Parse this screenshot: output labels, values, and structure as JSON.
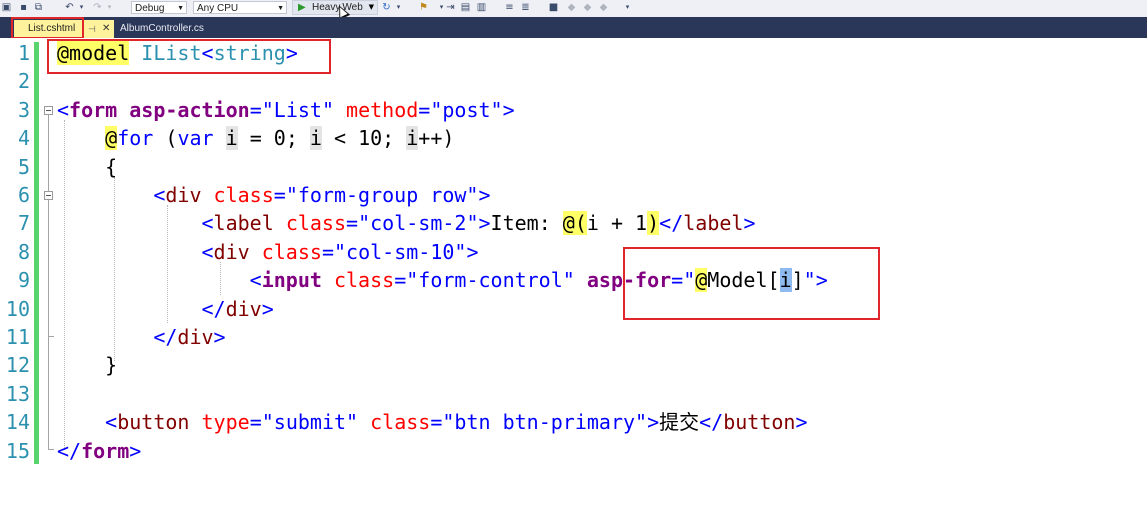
{
  "toolbar": {
    "config": "Debug",
    "platform": "Any CPU",
    "run_target": "Heavy.Web"
  },
  "tabs": [
    {
      "label": "List.cshtml",
      "active": true
    },
    {
      "label": "AlbumController.cs",
      "active": false
    }
  ],
  "editor": {
    "line_numbers": [
      "1",
      "2",
      "3",
      "4",
      "5",
      "6",
      "7",
      "8",
      "9",
      "10",
      "11",
      "12",
      "13",
      "14",
      "15"
    ],
    "lines": [
      {
        "num": "1",
        "tokens": [
          [
            "raz",
            "@model"
          ],
          [
            "txt",
            " "
          ],
          [
            "type",
            "IList"
          ],
          [
            "punc",
            "<"
          ],
          [
            "type",
            "string"
          ],
          [
            "punc",
            ">"
          ]
        ]
      },
      {
        "num": "2",
        "tokens": []
      },
      {
        "num": "3",
        "tokens": [
          [
            "punc",
            "<"
          ],
          [
            "tagb",
            "form"
          ],
          [
            "txt",
            " "
          ],
          [
            "helper",
            "asp-action"
          ],
          [
            "punc",
            "="
          ],
          [
            "str",
            "\"List\""
          ],
          [
            "txt",
            " "
          ],
          [
            "attr",
            "method"
          ],
          [
            "punc",
            "="
          ],
          [
            "str",
            "\"post\""
          ],
          [
            "punc",
            ">"
          ]
        ]
      },
      {
        "num": "4",
        "tokens": [
          [
            "txt",
            "    "
          ],
          [
            "raz",
            "@"
          ],
          [
            "kw",
            "for"
          ],
          [
            "txt",
            " ("
          ],
          [
            "kw",
            "var"
          ],
          [
            "txt",
            " "
          ],
          [
            "var",
            "i"
          ],
          [
            "txt",
            " = 0; "
          ],
          [
            "var",
            "i"
          ],
          [
            "txt",
            " < 10; "
          ],
          [
            "var",
            "i"
          ],
          [
            "txt",
            "++)"
          ]
        ]
      },
      {
        "num": "5",
        "tokens": [
          [
            "txt",
            "    {"
          ]
        ]
      },
      {
        "num": "6",
        "tokens": [
          [
            "txt",
            "        "
          ],
          [
            "punc",
            "<"
          ],
          [
            "tag",
            "div"
          ],
          [
            "txt",
            " "
          ],
          [
            "attr",
            "class"
          ],
          [
            "punc",
            "="
          ],
          [
            "str",
            "\"form-group row\""
          ],
          [
            "punc",
            ">"
          ]
        ]
      },
      {
        "num": "7",
        "tokens": [
          [
            "txt",
            "            "
          ],
          [
            "punc",
            "<"
          ],
          [
            "tag",
            "label"
          ],
          [
            "txt",
            " "
          ],
          [
            "attr",
            "class"
          ],
          [
            "punc",
            "="
          ],
          [
            "str",
            "\"col-sm-2\""
          ],
          [
            "punc",
            ">"
          ],
          [
            "txt",
            "Item: "
          ],
          [
            "raz",
            "@("
          ],
          [
            "txt",
            "i + 1"
          ],
          [
            "raz",
            ")"
          ],
          [
            "punc",
            "</"
          ],
          [
            "tag",
            "label"
          ],
          [
            "punc",
            ">"
          ]
        ]
      },
      {
        "num": "8",
        "tokens": [
          [
            "txt",
            "            "
          ],
          [
            "punc",
            "<"
          ],
          [
            "tag",
            "div"
          ],
          [
            "txt",
            " "
          ],
          [
            "attr",
            "class"
          ],
          [
            "punc",
            "="
          ],
          [
            "str",
            "\"col-sm-10\""
          ],
          [
            "punc",
            ">"
          ]
        ]
      },
      {
        "num": "9",
        "tokens": [
          [
            "txt",
            "                "
          ],
          [
            "punc",
            "<"
          ],
          [
            "tagb",
            "input"
          ],
          [
            "txt",
            " "
          ],
          [
            "attr",
            "class"
          ],
          [
            "punc",
            "="
          ],
          [
            "str",
            "\"form-control\""
          ],
          [
            "txt",
            " "
          ],
          [
            "helper",
            "asp-for"
          ],
          [
            "punc",
            "="
          ],
          [
            "str",
            "\""
          ],
          [
            "raz",
            "@"
          ],
          [
            "txt",
            "Model["
          ],
          [
            "sel",
            "i"
          ],
          [
            "txt",
            "]"
          ],
          [
            "str",
            "\""
          ],
          [
            "punc",
            ">"
          ]
        ]
      },
      {
        "num": "10",
        "tokens": [
          [
            "txt",
            "            "
          ],
          [
            "punc",
            "</"
          ],
          [
            "tag",
            "div"
          ],
          [
            "punc",
            ">"
          ]
        ]
      },
      {
        "num": "11",
        "tokens": [
          [
            "txt",
            "        "
          ],
          [
            "punc",
            "</"
          ],
          [
            "tag",
            "div"
          ],
          [
            "punc",
            ">"
          ]
        ]
      },
      {
        "num": "12",
        "tokens": [
          [
            "txt",
            "    }"
          ]
        ]
      },
      {
        "num": "13",
        "tokens": []
      },
      {
        "num": "14",
        "tokens": [
          [
            "txt",
            "    "
          ],
          [
            "punc",
            "<"
          ],
          [
            "tag",
            "button"
          ],
          [
            "txt",
            " "
          ],
          [
            "attr",
            "type"
          ],
          [
            "punc",
            "="
          ],
          [
            "str",
            "\"submit\""
          ],
          [
            "txt",
            " "
          ],
          [
            "attr",
            "class"
          ],
          [
            "punc",
            "="
          ],
          [
            "str",
            "\"btn btn-primary\""
          ],
          [
            "punc",
            ">"
          ],
          [
            "txt",
            "提交"
          ],
          [
            "punc",
            "</"
          ],
          [
            "tag",
            "button"
          ],
          [
            "punc",
            ">"
          ]
        ]
      },
      {
        "num": "15",
        "tokens": [
          [
            "punc",
            "</"
          ],
          [
            "tagb",
            "form"
          ],
          [
            "punc",
            ">"
          ]
        ]
      }
    ]
  },
  "colors": {
    "toolbar_bg": "#eef0f5",
    "tabstrip_bg": "#2b3758",
    "active_tab_bg": "#fff29d",
    "line_number": "#2b91af",
    "change_bar": "#57d46b",
    "razor_highlight": "#ffff66",
    "annotation_box": "#e0262b"
  }
}
